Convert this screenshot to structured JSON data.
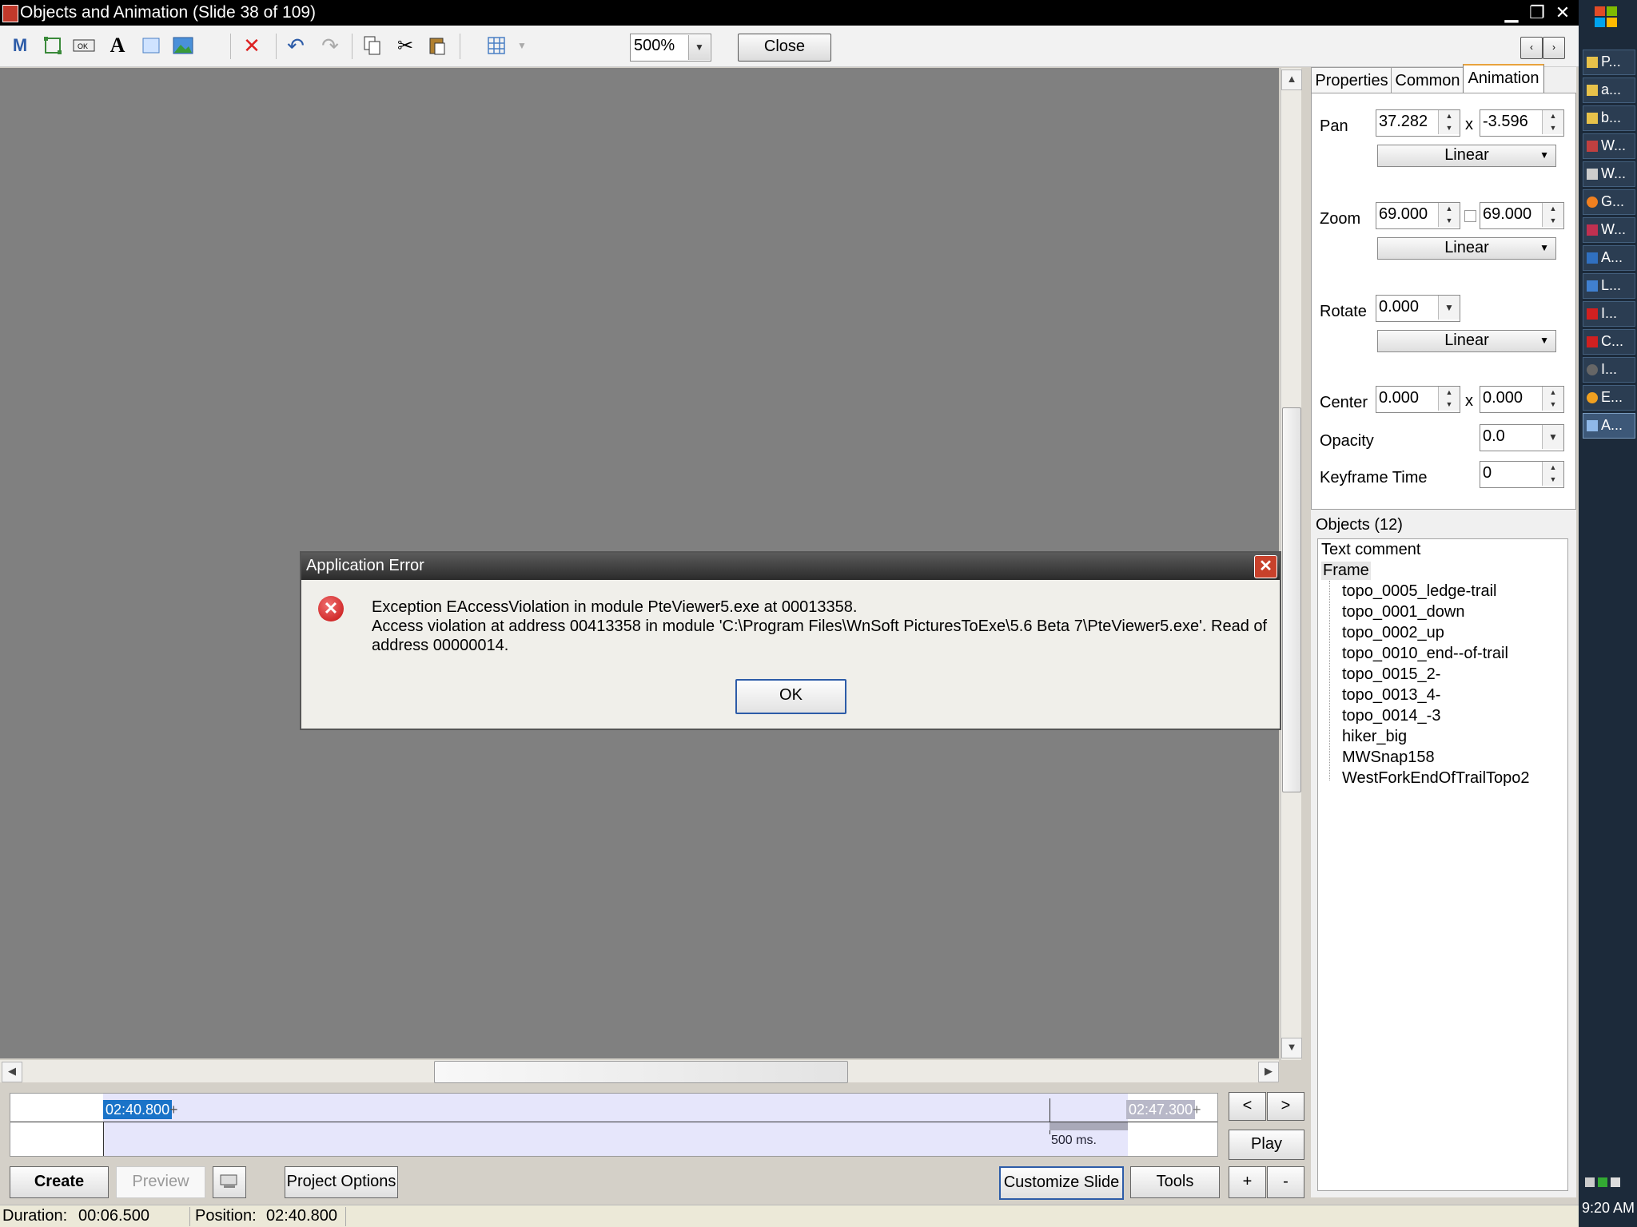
{
  "window": {
    "title": "Objects and Animation  (Slide 38 of 109)",
    "minimize": "▁",
    "restore": "❐",
    "close": "✕"
  },
  "toolbar": {
    "zoom_value": "500%",
    "close_label": "Close"
  },
  "right_panel": {
    "tabs": [
      "Properties",
      "Common",
      "Animation"
    ],
    "active_tab": "Animation",
    "pan": {
      "label": "Pan",
      "x": "37.282",
      "y": "-3.596",
      "sep": "x",
      "mode": "Linear"
    },
    "zoom": {
      "label": "Zoom",
      "x": "69.000",
      "y": "69.000",
      "mode": "Linear"
    },
    "rotate": {
      "label": "Rotate",
      "value": "0.000",
      "mode": "Linear"
    },
    "center": {
      "label": "Center",
      "x": "0.000",
      "y": "0.000",
      "sep": "x"
    },
    "opacity": {
      "label": "Opacity",
      "value": "0.0"
    },
    "keyframe_time": {
      "label": "Keyframe Time",
      "value": "0"
    },
    "objects_header": "Objects (12)",
    "objects": [
      "Text comment",
      "Frame",
      "topo_0005_ledge-trail",
      "topo_0001_down",
      "topo_0002_up",
      "topo_0010_end--of-trail",
      "topo_0015_2-",
      "topo_0013_4-",
      "topo_0014_-3",
      "hiker_big",
      "MWSnap158",
      "WestForkEndOfTrailTopo2"
    ]
  },
  "timeline": {
    "start_time": "02:40.800",
    "end_time": "02:47.300",
    "interval_label": "500 ms.",
    "prev": "<",
    "next": ">",
    "play": "Play"
  },
  "bottom_buttons": {
    "create": "Create",
    "preview": "Preview",
    "project_options": "Project Options",
    "customize_slide": "Customize Slide",
    "tools": "Tools",
    "plus": "+",
    "minus": "-"
  },
  "status": {
    "duration_label": "Duration:",
    "duration_value": "00:06.500",
    "position_label": "Position:",
    "position_value": "02:40.800"
  },
  "dialog": {
    "title": "Application Error",
    "line1": "Exception EAccessViolation in module PteViewer5.exe at 00013358.",
    "line2": "Access violation at address 00413358 in module 'C:\\Program Files\\WnSoft PicturesToExe\\5.6 Beta 7\\PteViewer5.exe'. Read of address 00000014.",
    "ok": "OK",
    "close_glyph": "✕",
    "icon_glyph": "✕"
  },
  "taskbar": {
    "items": [
      "P...",
      "a...",
      "b...",
      "W...",
      "W...",
      "G...",
      "W...",
      "A...",
      "L...",
      "I...",
      "C...",
      "I...",
      "E...",
      "A..."
    ],
    "clock": "9:20 AM"
  }
}
